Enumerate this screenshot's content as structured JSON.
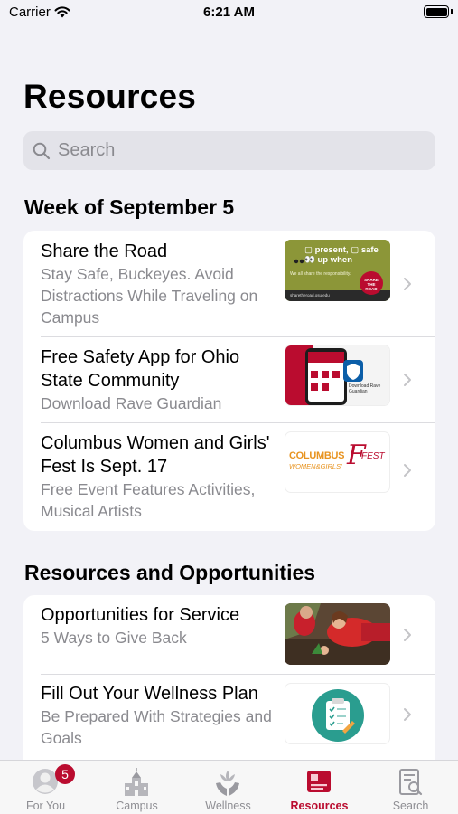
{
  "status_bar": {
    "carrier": "Carrier",
    "time": "6:21 AM"
  },
  "page_title": "Resources",
  "search": {
    "placeholder": "Search"
  },
  "sections": [
    {
      "header": "Week of September 5",
      "items": [
        {
          "title": "Share the Road",
          "subtitle": "Stay Safe, Buckeyes. Avoid Distractions While Traveling on Campus",
          "thumb_text": "▢ present, ▢ safe 👀 up when",
          "thumb_caption": "We all share the responsibility.",
          "thumb_badge": "SHARE THE ROAD",
          "thumb_url": "sharetheroad.osu.edu"
        },
        {
          "title": "Free Safety App for Ohio State Community",
          "subtitle": "Download Rave Guardian",
          "thumb_text": "Download Rave Guardian"
        },
        {
          "title": "Columbus Women and Girls' Fest Is Sept. 17",
          "subtitle": "Free Event Features Activities, Musical Artists",
          "thumb_text_1": "COLUMBUS",
          "thumb_text_2": "WOMEN&GIRLS'",
          "thumb_text_3": "FEST"
        }
      ]
    },
    {
      "header": "Resources and Opportunities",
      "items": [
        {
          "title": "Opportunities for Service",
          "subtitle": "5 Ways to Give Back"
        },
        {
          "title": "Fill Out Your Wellness Plan",
          "subtitle": "Be Prepared With Strategies and Goals"
        }
      ]
    }
  ],
  "tabs": [
    {
      "label": "For You",
      "badge": "5",
      "icon": "person-icon"
    },
    {
      "label": "Campus",
      "icon": "building-icon"
    },
    {
      "label": "Wellness",
      "icon": "wellness-hands-icon"
    },
    {
      "label": "Resources",
      "icon": "resources-icon",
      "active": true
    },
    {
      "label": "Search",
      "icon": "search-doc-icon"
    }
  ],
  "colors": {
    "accent": "#ba0c2f",
    "background": "#f2f2f7",
    "secondary_text": "#8a8a8f"
  }
}
